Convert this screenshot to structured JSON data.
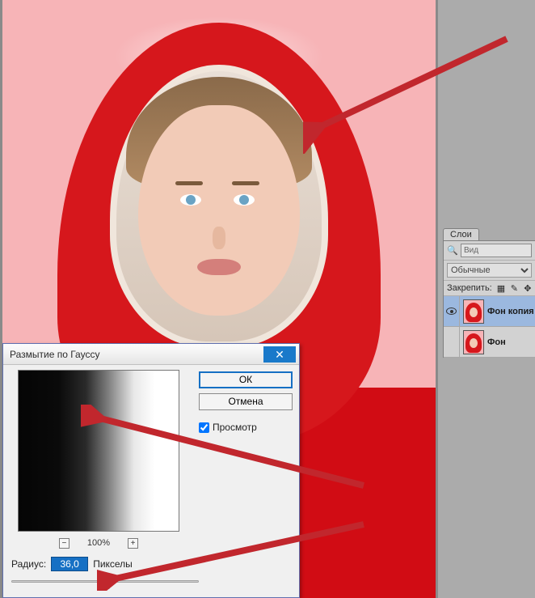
{
  "dialog": {
    "title": "Размытие по Гауссу",
    "ok": "ОК",
    "cancel": "Отмена",
    "preview_label": "Просмотр",
    "preview_checked": true,
    "zoom": "100%",
    "radius_label": "Радиус:",
    "radius_value": "36,0",
    "radius_unit": "Пикселы"
  },
  "layers_panel": {
    "tab": "Слои",
    "search_placeholder": "Вид",
    "blend_mode": "Обычные",
    "lock_label": "Закрепить:",
    "layers": [
      {
        "name": "Фон копия",
        "visible": true,
        "active": true
      },
      {
        "name": "Фон",
        "visible": false,
        "active": false
      }
    ]
  },
  "icons": {
    "search": "🔍",
    "close": "✕",
    "minus": "−",
    "plus": "+",
    "checker": "▦",
    "brush": "✎",
    "move": "✥"
  }
}
